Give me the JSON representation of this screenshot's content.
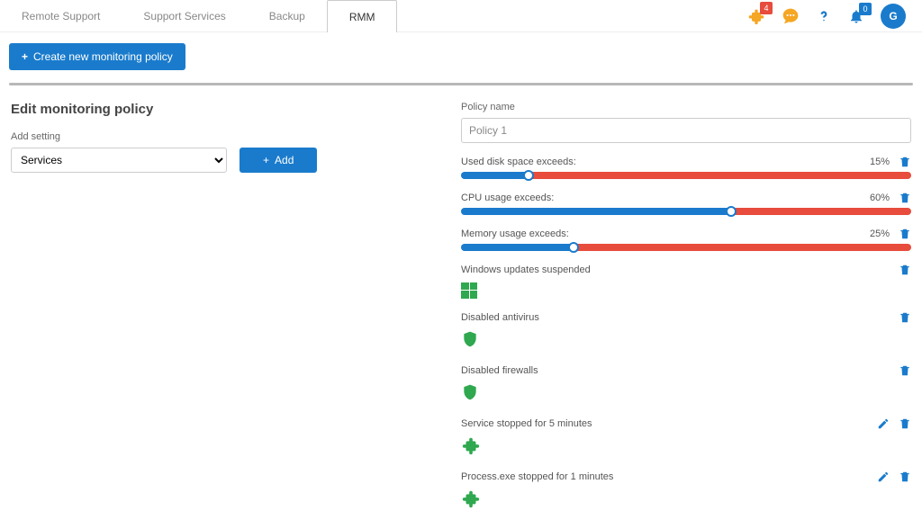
{
  "nav": {
    "tabs": [
      "Remote Support",
      "Support Services",
      "Backup",
      "RMM"
    ],
    "active_index": 3,
    "puzzle_badge": "4",
    "bell_badge": "0",
    "avatar_letter": "G"
  },
  "actions": {
    "create_label": "Create new monitoring policy"
  },
  "page": {
    "title": "Edit monitoring policy",
    "add_setting_label": "Add setting",
    "add_setting_select": "Services",
    "add_button": "Add",
    "policy_name_label": "Policy name",
    "policy_name_value": "Policy 1"
  },
  "settings": [
    {
      "label": "Used disk space exceeds:",
      "percent": 15,
      "type": "slider"
    },
    {
      "label": "CPU usage exceeds:",
      "percent": 60,
      "type": "slider"
    },
    {
      "label": "Memory usage exceeds:",
      "percent": 25,
      "type": "slider"
    },
    {
      "label": "Windows updates suspended",
      "type": "windows"
    },
    {
      "label": "Disabled antivirus",
      "type": "shield"
    },
    {
      "label": "Disabled firewalls",
      "type": "shield"
    },
    {
      "label": "Service stopped for 5 minutes",
      "type": "puzzle",
      "editable": true
    },
    {
      "label": "Process.exe stopped for 1 minutes",
      "type": "puzzle",
      "editable": true
    }
  ]
}
